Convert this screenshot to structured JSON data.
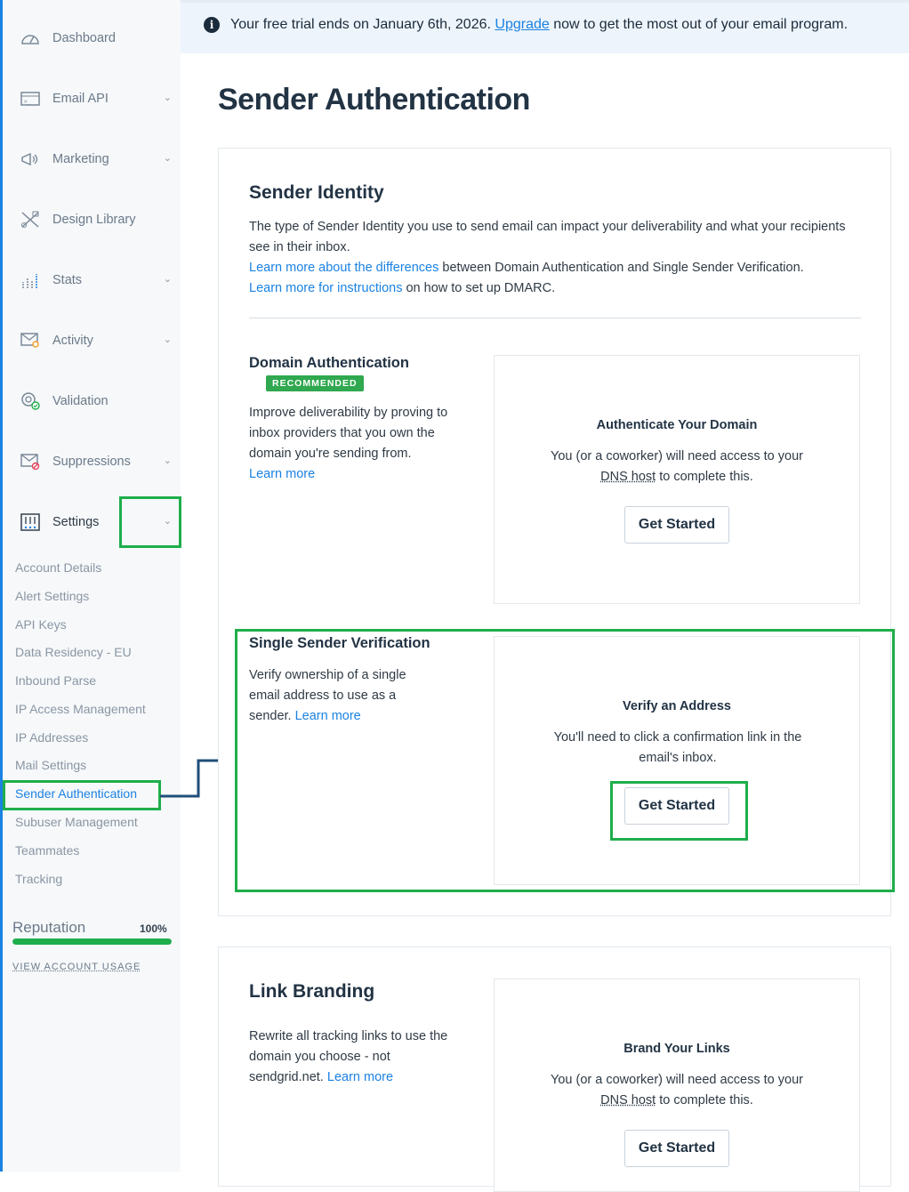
{
  "banner": {
    "text_before": "Your free trial ends on January 6th, 2026. ",
    "link": "Upgrade",
    "text_after": " now to get the most out of your email program."
  },
  "sidebar": {
    "items": [
      {
        "label": "Dashboard",
        "icon": "gauge-icon"
      },
      {
        "label": "Email API",
        "icon": "terminal-icon"
      },
      {
        "label": "Marketing",
        "icon": "megaphone-icon"
      },
      {
        "label": "Design Library",
        "icon": "design-tools-icon"
      },
      {
        "label": "Stats",
        "icon": "bar-chart-icon"
      },
      {
        "label": "Activity",
        "icon": "envelope-search-icon"
      },
      {
        "label": "Validation",
        "icon": "at-check-icon"
      },
      {
        "label": "Suppressions",
        "icon": "envelope-block-icon"
      },
      {
        "label": "Settings",
        "icon": "sliders-icon"
      }
    ],
    "settings_sub": [
      "Account Details",
      "Alert Settings",
      "API Keys",
      "Data Residency - EU",
      "Inbound Parse",
      "IP Access Management",
      "IP Addresses",
      "Mail Settings",
      "Sender Authentication",
      "Subuser Management",
      "Teammates",
      "Tracking"
    ],
    "reputation": {
      "label": "Reputation",
      "value_text": "100%",
      "value": 1.0
    },
    "usage_link": "VIEW ACCOUNT USAGE"
  },
  "page_title": "Sender Authentication",
  "sender_identity": {
    "title": "Sender Identity",
    "desc": "The type of Sender Identity you use to send email can impact your deliverability and what your recipients see in their inbox.",
    "line2_link": "Learn more about the differences",
    "line2_rest": " between Domain Authentication and Single Sender Verification.",
    "line3_link": "Learn more for instructions",
    "line3_rest": " on how to set up DMARC."
  },
  "domain_auth": {
    "title": "Domain Authentication",
    "badge": "RECOMMENDED",
    "desc": "Improve deliverability by proving to inbox providers that you own the domain you're sending from.",
    "learn_more": "Learn more",
    "panel_title": "Authenticate Your Domain",
    "panel_desc_1": "You (or a coworker) will need access to your",
    "panel_dns": "DNS host",
    "panel_desc_2": " to complete this.",
    "button": "Get Started"
  },
  "single_sender": {
    "title": "Single Sender Verification",
    "desc": "Verify ownership of a single email address to use as a sender. ",
    "learn_more": "Learn more",
    "panel_title": "Verify an Address",
    "panel_desc": "You'll need to click a confirmation link in the email's inbox.",
    "button": "Get Started"
  },
  "link_branding": {
    "title": "Link Branding",
    "desc": "Rewrite all tracking links to use the domain you choose - not sendgrid.net. ",
    "learn_more": "Learn more",
    "panel_title": "Brand Your Links",
    "panel_desc_1": "You (or a coworker) will need access to your",
    "panel_dns": "DNS host",
    "panel_desc_2": " to complete this.",
    "button": "Get Started"
  },
  "colors": {
    "accent": "#1a82e2",
    "highlight": "#1fae4b",
    "arrow": "#1f4e79"
  }
}
